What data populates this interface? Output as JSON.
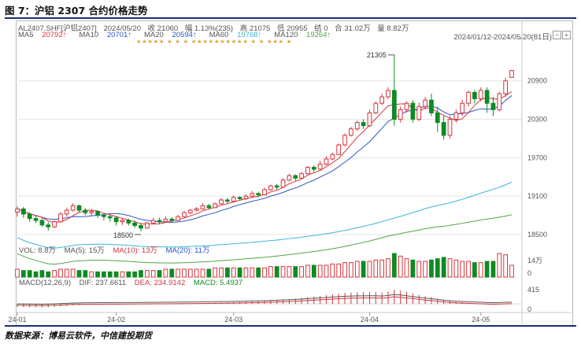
{
  "figure_title": "图 7：沪铝 2307 合约价格走势",
  "source": "数据来源：博易云软件，中信建投期货",
  "header": {
    "symbol": "AL2407.SHF[沪铝2407]",
    "date": "2024/05/20",
    "close": "收 21060",
    "change": "幅 1.13%(235)",
    "high": "高 21075",
    "low": "低 20955",
    "settle": "结 0",
    "amount": "合 31.02万",
    "volume": "量 8.82万",
    "range": "2024/01/12-2024/05/20(81日)",
    "minus": "−",
    "plus": "+"
  },
  "ma_header": [
    {
      "label": "MA5",
      "value": "20792↑",
      "color": "#d4343c"
    },
    {
      "label": "MA10",
      "value": "20701↑",
      "color": "#2a56c6"
    },
    {
      "label": "MA20",
      "value": "20594↑",
      "color": "#2a56c6"
    },
    {
      "label": "MA60",
      "value": "19768↑",
      "color": "#3db6d6"
    },
    {
      "label": "MA120",
      "value": "19264↑",
      "color": "#55a04a"
    }
  ],
  "star_row1": "★★★★★ ★ ★ ★ ★★★★★★★★★★ ★ ★ ★★★ ★",
  "star_row2": "★ ★★★",
  "vol_header": {
    "title": "VOL: 8.8万",
    "ma5": "MA(5): 15万",
    "ma10": "MA(10): 13万",
    "ma20": "MA(20): 11万"
  },
  "macd_header": {
    "title": "MACD(12,26,9)",
    "dif": "DIF: 237.6611",
    "dea": "DEA: 234.9142",
    "macd": "MACD: 5.4937"
  },
  "colors": {
    "up": "#d4343c",
    "down": "#0f8a22",
    "ma5": "#d4343c",
    "ma10": "#2a56c6",
    "ma60": "#3db6d6",
    "ma120": "#55a04a"
  },
  "chart_data": [
    {
      "type": "candlestick",
      "title": "",
      "y_ticks": [
        18500,
        19100,
        19700,
        20300,
        20900
      ],
      "ylim": [
        18450,
        21450
      ],
      "x_ticks": [
        "24-01",
        "24-02",
        "24-03",
        "24-04",
        "24-05"
      ],
      "annotations": [
        {
          "label": "21305",
          "value": 21305
        },
        {
          "label": "18500",
          "value": 18500
        }
      ],
      "candles": [
        [
          18850,
          18900,
          18780,
          18940
        ],
        [
          18900,
          18820,
          18760,
          18930
        ],
        [
          18820,
          18750,
          18700,
          18850
        ],
        [
          18750,
          18720,
          18680,
          18800
        ],
        [
          18720,
          18650,
          18620,
          18760
        ],
        [
          18650,
          18620,
          18560,
          18700
        ],
        [
          18620,
          18700,
          18600,
          18720
        ],
        [
          18700,
          18820,
          18680,
          18850
        ],
        [
          18820,
          18880,
          18780,
          18920
        ],
        [
          18880,
          18950,
          18860,
          18990
        ],
        [
          18950,
          18880,
          18840,
          18970
        ],
        [
          18880,
          18840,
          18800,
          18910
        ],
        [
          18840,
          18860,
          18800,
          18900
        ],
        [
          18860,
          18800,
          18760,
          18880
        ],
        [
          18800,
          18780,
          18720,
          18830
        ],
        [
          18780,
          18760,
          18700,
          18810
        ],
        [
          18760,
          18700,
          18640,
          18790
        ],
        [
          18700,
          18720,
          18650,
          18760
        ],
        [
          18720,
          18680,
          18640,
          18750
        ],
        [
          18680,
          18640,
          18600,
          18720
        ],
        [
          18640,
          18600,
          18550,
          18680
        ],
        [
          18600,
          18680,
          18590,
          18700
        ],
        [
          18680,
          18720,
          18660,
          18760
        ],
        [
          18720,
          18700,
          18660,
          18760
        ],
        [
          18700,
          18740,
          18690,
          18780
        ],
        [
          18740,
          18720,
          18690,
          18770
        ],
        [
          18720,
          18780,
          18710,
          18810
        ],
        [
          18780,
          18840,
          18770,
          18870
        ],
        [
          18840,
          18880,
          18820,
          18900
        ],
        [
          18880,
          18900,
          18860,
          18930
        ],
        [
          18900,
          18950,
          18890,
          18990
        ],
        [
          18950,
          18920,
          18890,
          18980
        ],
        [
          18920,
          18980,
          18910,
          19000
        ],
        [
          18980,
          19040,
          18970,
          19070
        ],
        [
          19040,
          19020,
          18990,
          19070
        ],
        [
          19020,
          19080,
          19000,
          19110
        ],
        [
          19080,
          19060,
          19030,
          19100
        ],
        [
          19060,
          19100,
          19040,
          19130
        ],
        [
          19100,
          19140,
          19080,
          19180
        ],
        [
          19140,
          19120,
          19080,
          19170
        ],
        [
          19120,
          19200,
          19110,
          19230
        ],
        [
          19200,
          19260,
          19180,
          19280
        ],
        [
          19260,
          19240,
          19200,
          19290
        ],
        [
          19240,
          19350,
          19230,
          19380
        ],
        [
          19350,
          19420,
          19330,
          19450
        ],
        [
          19420,
          19380,
          19340,
          19440
        ],
        [
          19380,
          19450,
          19370,
          19480
        ],
        [
          19450,
          19550,
          19440,
          19570
        ],
        [
          19550,
          19520,
          19480,
          19580
        ],
        [
          19520,
          19600,
          19500,
          19650
        ],
        [
          19600,
          19680,
          19580,
          19720
        ],
        [
          19680,
          19750,
          19660,
          19780
        ],
        [
          19750,
          19900,
          19740,
          19920
        ],
        [
          19900,
          20050,
          19880,
          20080
        ],
        [
          20050,
          20150,
          20030,
          20180
        ],
        [
          20150,
          20250,
          20120,
          20280
        ],
        [
          20250,
          20200,
          20150,
          20300
        ],
        [
          20200,
          20400,
          20180,
          20450
        ],
        [
          20400,
          20550,
          20380,
          20580
        ],
        [
          20550,
          20650,
          20520,
          20700
        ],
        [
          20650,
          20750,
          20620,
          20800
        ],
        [
          20750,
          20300,
          20200,
          21305
        ],
        [
          20300,
          20450,
          20250,
          20500
        ],
        [
          20450,
          20550,
          20400,
          20580
        ],
        [
          20550,
          20300,
          20250,
          20600
        ],
        [
          20300,
          20500,
          20270,
          20560
        ],
        [
          20500,
          20600,
          20450,
          20650
        ],
        [
          20600,
          20400,
          20350,
          20700
        ],
        [
          20400,
          20250,
          20100,
          20500
        ],
        [
          20250,
          20050,
          19980,
          20350
        ],
        [
          20050,
          20300,
          20000,
          20350
        ],
        [
          20300,
          20400,
          20250,
          20450
        ],
        [
          20400,
          20550,
          20350,
          20600
        ],
        [
          20550,
          20720,
          20500,
          20750
        ],
        [
          20720,
          20620,
          20550,
          20760
        ],
        [
          20620,
          20750,
          20580,
          20800
        ],
        [
          20750,
          20550,
          20400,
          20800
        ],
        [
          20550,
          20450,
          20350,
          20650
        ],
        [
          20450,
          20700,
          20420,
          20730
        ],
        [
          20700,
          20900,
          20650,
          20950
        ],
        [
          20955,
          21060,
          20955,
          21075
        ]
      ]
    },
    {
      "type": "bar",
      "title": "VOL",
      "y_ticks": [
        "14万",
        "0"
      ],
      "values": [
        6,
        5,
        5,
        4,
        5,
        4,
        5,
        6,
        6,
        6,
        5,
        5,
        4,
        4,
        4,
        4,
        4,
        4,
        4,
        4,
        5,
        5,
        5,
        5,
        6,
        6,
        6,
        6,
        6,
        6,
        6,
        6,
        7,
        7,
        7,
        7,
        7,
        7,
        7,
        7,
        7,
        8,
        8,
        8,
        8,
        8,
        8,
        9,
        9,
        9,
        9,
        10,
        10,
        11,
        11,
        12,
        12,
        12,
        13,
        13,
        14,
        18,
        16,
        14,
        13,
        12,
        12,
        13,
        14,
        15,
        14,
        13,
        12,
        12,
        11,
        11,
        12,
        12,
        18,
        17,
        9
      ]
    },
    {
      "type": "bar",
      "title": "MACD",
      "y_ticks": [
        "415",
        "0"
      ],
      "values": [
        -60,
        -65,
        -70,
        -72,
        -75,
        -70,
        -60,
        -50,
        -40,
        -30,
        -25,
        -20,
        -18,
        -16,
        -15,
        -14,
        -13,
        -12,
        -10,
        -8,
        -6,
        -4,
        -2,
        0,
        2,
        4,
        6,
        8,
        10,
        12,
        15,
        18,
        22,
        26,
        30,
        34,
        38,
        42,
        48,
        55,
        62,
        70,
        80,
        90,
        100,
        110,
        125,
        140,
        155,
        170,
        185,
        200,
        215,
        230,
        240,
        245,
        248,
        250,
        250,
        240,
        260,
        300,
        280,
        250,
        220,
        190,
        160,
        140,
        110,
        80,
        60,
        40,
        30,
        20,
        10,
        0,
        -10,
        -15,
        -10,
        0,
        5
      ]
    }
  ]
}
